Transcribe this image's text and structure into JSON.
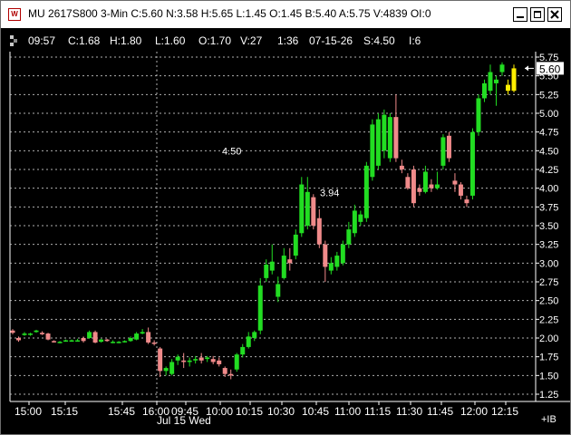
{
  "window": {
    "title": "MU 2617S800 3-Min C:5.60 N:3.58 H:5.65 L:1.45 O:1.45 B:5.40 A:5.75 V:4839 OI:0",
    "icon": "chart-app-icon",
    "controls": {
      "minimize": "minimize-icon",
      "maximize": "maximize-icon",
      "close": "close-icon"
    }
  },
  "header": {
    "time": "09:57",
    "close": "C:1.68",
    "high": "H:1.80",
    "low": "L:1.60",
    "open": "O:1.70",
    "volume": "V:27",
    "interval": "1:36",
    "date": "07-15-26",
    "strike": "S:4.50",
    "field_i": "I:6"
  },
  "chart_data": {
    "type": "candlestick",
    "y_ticks": [
      "5.75",
      "5.50",
      "5.25",
      "5.00",
      "4.75",
      "4.50",
      "4.25",
      "4.00",
      "3.75",
      "3.50",
      "3.25",
      "3.00",
      "2.75",
      "2.50",
      "2.25",
      "2.00",
      "1.75",
      "1.50",
      "1.25"
    ],
    "y_range": [
      1.25,
      5.75
    ],
    "x_ticks": [
      "15:00",
      "15:15",
      "15:45",
      "16:00",
      "09:45",
      "10:00",
      "10:15",
      "10:30",
      "10:45",
      "11:00",
      "11:15",
      "11:30",
      "11:45",
      "12:00",
      "12:15"
    ],
    "date_label": "Jul 15 Wed",
    "annotations": [
      {
        "text": "4.50",
        "price": 4.5
      },
      {
        "text": "3.94",
        "price": 3.94
      }
    ],
    "last_price": "5.60",
    "corner_label": "+IB",
    "colors": {
      "up": "#22dd22",
      "down": "#f08a8a",
      "last": "#ffee00",
      "grid": "#cfcfcf",
      "background": "#000000"
    },
    "candles": [
      {
        "o": 2.1,
        "h": 2.12,
        "l": 2.05,
        "c": 2.07
      },
      {
        "o": 2.0,
        "h": 2.02,
        "l": 1.95,
        "c": 1.97
      },
      {
        "o": 2.04,
        "h": 2.08,
        "l": 2.03,
        "c": 2.06
      },
      {
        "o": 2.05,
        "h": 2.07,
        "l": 2.03,
        "c": 2.06
      },
      {
        "o": 2.08,
        "h": 2.11,
        "l": 2.07,
        "c": 2.1
      },
      {
        "o": 2.07,
        "h": 2.09,
        "l": 2.04,
        "c": 2.05
      },
      {
        "o": 2.06,
        "h": 2.07,
        "l": 1.97,
        "c": 1.98
      },
      {
        "o": 1.96,
        "h": 1.97,
        "l": 1.94,
        "c": 1.95
      },
      {
        "o": 1.95,
        "h": 1.96,
        "l": 1.93,
        "c": 1.95
      },
      {
        "o": 1.96,
        "h": 1.98,
        "l": 1.95,
        "c": 1.97
      },
      {
        "o": 1.96,
        "h": 1.98,
        "l": 1.95,
        "c": 1.97
      },
      {
        "o": 1.97,
        "h": 1.99,
        "l": 1.96,
        "c": 1.97
      },
      {
        "o": 2.0,
        "h": 2.02,
        "l": 1.94,
        "c": 1.96
      },
      {
        "o": 2.0,
        "h": 2.1,
        "l": 1.99,
        "c": 2.08
      },
      {
        "o": 2.08,
        "h": 2.1,
        "l": 1.93,
        "c": 1.94
      },
      {
        "o": 1.95,
        "h": 1.99,
        "l": 1.94,
        "c": 1.98
      },
      {
        "o": 1.98,
        "h": 1.99,
        "l": 1.95,
        "c": 1.96
      },
      {
        "o": 1.95,
        "h": 1.97,
        "l": 1.93,
        "c": 1.95
      },
      {
        "o": 1.94,
        "h": 1.96,
        "l": 1.93,
        "c": 1.95
      },
      {
        "o": 1.95,
        "h": 1.97,
        "l": 1.94,
        "c": 1.96
      },
      {
        "o": 1.96,
        "h": 2.02,
        "l": 1.95,
        "c": 2.0
      },
      {
        "o": 1.98,
        "h": 2.08,
        "l": 1.97,
        "c": 2.06
      },
      {
        "o": 2.06,
        "h": 2.12,
        "l": 2.05,
        "c": 2.08
      },
      {
        "o": 2.08,
        "h": 2.14,
        "l": 1.92,
        "c": 1.94
      },
      {
        "o": 1.94,
        "h": 1.97,
        "l": 1.9,
        "c": 1.93
      },
      {
        "o": 1.86,
        "h": 1.88,
        "l": 1.48,
        "c": 1.56
      },
      {
        "o": 1.56,
        "h": 1.62,
        "l": 1.5,
        "c": 1.6
      },
      {
        "o": 1.52,
        "h": 1.72,
        "l": 1.5,
        "c": 1.68
      },
      {
        "o": 1.7,
        "h": 1.78,
        "l": 1.64,
        "c": 1.75
      },
      {
        "o": 1.7,
        "h": 1.8,
        "l": 1.6,
        "c": 1.68
      },
      {
        "o": 1.68,
        "h": 1.74,
        "l": 1.62,
        "c": 1.7
      },
      {
        "o": 1.7,
        "h": 1.76,
        "l": 1.66,
        "c": 1.72
      },
      {
        "o": 1.74,
        "h": 1.8,
        "l": 1.66,
        "c": 1.7
      },
      {
        "o": 1.72,
        "h": 1.76,
        "l": 1.68,
        "c": 1.74
      },
      {
        "o": 1.72,
        "h": 1.76,
        "l": 1.65,
        "c": 1.68
      },
      {
        "o": 1.7,
        "h": 1.74,
        "l": 1.62,
        "c": 1.65
      },
      {
        "o": 1.6,
        "h": 1.62,
        "l": 1.48,
        "c": 1.52
      },
      {
        "o": 1.52,
        "h": 1.58,
        "l": 1.45,
        "c": 1.5
      },
      {
        "o": 1.58,
        "h": 1.8,
        "l": 1.55,
        "c": 1.78
      },
      {
        "o": 1.78,
        "h": 1.92,
        "l": 1.74,
        "c": 1.88
      },
      {
        "o": 1.88,
        "h": 2.08,
        "l": 1.86,
        "c": 2.02
      },
      {
        "o": 2.0,
        "h": 2.1,
        "l": 1.96,
        "c": 2.08
      },
      {
        "o": 2.1,
        "h": 2.8,
        "l": 2.05,
        "c": 2.7
      },
      {
        "o": 2.8,
        "h": 3.05,
        "l": 2.75,
        "c": 2.98
      },
      {
        "o": 2.9,
        "h": 3.25,
        "l": 2.85,
        "c": 3.02
      },
      {
        "o": 2.55,
        "h": 2.82,
        "l": 2.48,
        "c": 2.72
      },
      {
        "o": 2.8,
        "h": 3.2,
        "l": 2.78,
        "c": 3.1
      },
      {
        "o": 3.05,
        "h": 3.2,
        "l": 2.9,
        "c": 3.0
      },
      {
        "o": 3.1,
        "h": 3.45,
        "l": 3.05,
        "c": 3.38
      },
      {
        "o": 3.4,
        "h": 4.15,
        "l": 3.35,
        "c": 4.05
      },
      {
        "o": 3.5,
        "h": 4.15,
        "l": 3.45,
        "c": 3.95
      },
      {
        "o": 3.88,
        "h": 3.92,
        "l": 3.45,
        "c": 3.5
      },
      {
        "o": 3.6,
        "h": 3.72,
        "l": 3.2,
        "c": 3.25
      },
      {
        "o": 3.25,
        "h": 3.3,
        "l": 2.75,
        "c": 2.95
      },
      {
        "o": 2.9,
        "h": 3.08,
        "l": 2.85,
        "c": 3.0
      },
      {
        "o": 2.95,
        "h": 3.15,
        "l": 2.9,
        "c": 3.1
      },
      {
        "o": 3.0,
        "h": 3.3,
        "l": 2.97,
        "c": 3.25
      },
      {
        "o": 3.25,
        "h": 3.55,
        "l": 3.2,
        "c": 3.45
      },
      {
        "o": 3.4,
        "h": 3.78,
        "l": 3.35,
        "c": 3.7
      },
      {
        "o": 3.55,
        "h": 3.7,
        "l": 3.5,
        "c": 3.65
      },
      {
        "o": 3.6,
        "h": 4.35,
        "l": 3.55,
        "c": 4.3
      },
      {
        "o": 4.15,
        "h": 4.92,
        "l": 4.1,
        "c": 4.85
      },
      {
        "o": 4.3,
        "h": 5.0,
        "l": 4.25,
        "c": 4.92
      },
      {
        "o": 4.5,
        "h": 5.05,
        "l": 4.4,
        "c": 4.98
      },
      {
        "o": 4.4,
        "h": 5.0,
        "l": 4.35,
        "c": 4.95
      },
      {
        "o": 4.95,
        "h": 5.25,
        "l": 4.35,
        "c": 4.4
      },
      {
        "o": 4.3,
        "h": 4.38,
        "l": 4.2,
        "c": 4.25
      },
      {
        "o": 4.15,
        "h": 4.2,
        "l": 3.98,
        "c": 4.0
      },
      {
        "o": 4.25,
        "h": 4.3,
        "l": 3.75,
        "c": 3.8
      },
      {
        "o": 4.0,
        "h": 4.05,
        "l": 3.9,
        "c": 3.95
      },
      {
        "o": 3.95,
        "h": 4.3,
        "l": 3.93,
        "c": 4.22
      },
      {
        "o": 4.05,
        "h": 4.12,
        "l": 3.95,
        "c": 4.0
      },
      {
        "o": 4.0,
        "h": 4.22,
        "l": 3.98,
        "c": 4.05
      },
      {
        "o": 4.3,
        "h": 4.72,
        "l": 4.25,
        "c": 4.68
      },
      {
        "o": 4.7,
        "h": 4.75,
        "l": 4.35,
        "c": 4.4
      },
      {
        "o": 4.1,
        "h": 4.2,
        "l": 3.95,
        "c": 4.05
      },
      {
        "o": 4.05,
        "h": 4.08,
        "l": 3.85,
        "c": 3.9
      },
      {
        "o": 3.85,
        "h": 3.9,
        "l": 3.75,
        "c": 3.8
      },
      {
        "o": 3.9,
        "h": 4.8,
        "l": 3.85,
        "c": 4.75
      },
      {
        "o": 4.75,
        "h": 5.25,
        "l": 4.7,
        "c": 5.2
      },
      {
        "o": 5.2,
        "h": 5.45,
        "l": 5.15,
        "c": 5.4
      },
      {
        "o": 5.3,
        "h": 5.65,
        "l": 5.25,
        "c": 5.55
      },
      {
        "o": 5.4,
        "h": 5.5,
        "l": 5.1,
        "c": 5.45
      },
      {
        "o": 5.55,
        "h": 5.68,
        "l": 5.5,
        "c": 5.65
      },
      {
        "o": 5.38,
        "h": 5.45,
        "l": 5.25,
        "c": 5.3
      },
      {
        "o": 5.3,
        "h": 5.65,
        "l": 5.28,
        "c": 5.6
      }
    ]
  }
}
